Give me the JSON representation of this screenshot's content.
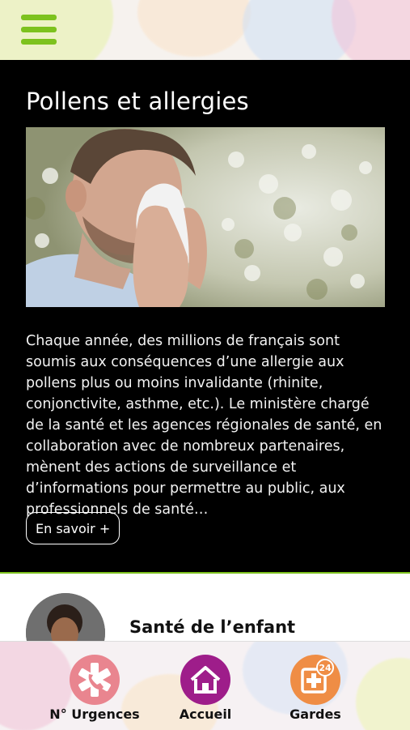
{
  "header": {
    "menu_icon": "hamburger-menu-icon"
  },
  "article": {
    "title": "Pollens et allergies",
    "body": "Chaque année, des millions de français sont soumis aux conséquences d’une allergie aux pollens plus ou moins invalidante (rhinite, conjonctivite, asthme, etc.). Le ministère chargé de la santé et les agences régionales de santé, en collaboration avec de nombreux partenaires, mènent des actions de surveillance et d’informations pour permettre au public, aux professionnels de santé…",
    "more_label": "En savoir +"
  },
  "next_section": {
    "title": "Santé de l’enfant"
  },
  "tabbar": {
    "items": [
      {
        "label": "N° Urgences",
        "icon": "emergency-phone-icon",
        "color": "#e9858f"
      },
      {
        "label": "Accueil",
        "icon": "home-icon",
        "color": "#9e1d8a"
      },
      {
        "label": "Gardes",
        "icon": "pharmacy-24h-icon",
        "color": "#ef8d45",
        "badge": "24"
      }
    ]
  },
  "colors": {
    "accent": "#7dc21e",
    "card_bg": "#000000"
  }
}
